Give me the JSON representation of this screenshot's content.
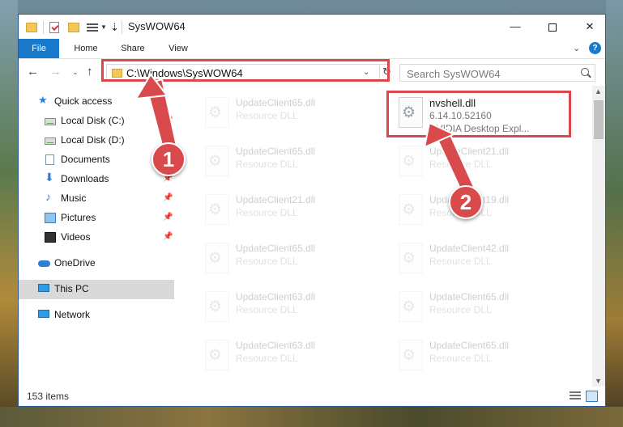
{
  "window": {
    "title": "SysWOW64",
    "controls": {
      "minimize": "—",
      "maximize": "",
      "close": "✕"
    }
  },
  "ribbon": {
    "tabs": [
      "File",
      "Home",
      "Share",
      "View"
    ],
    "chevron": "⌄",
    "help": "?"
  },
  "nav": {
    "back": "←",
    "forward": "→",
    "recent": "⌄",
    "up": "↑",
    "address": "C:\\Windows\\SysWOW64",
    "address_dropdown": "⌄",
    "refresh": "↻",
    "search_placeholder": "Search SysWOW64"
  },
  "sidebar": {
    "items": [
      {
        "label": "Quick access",
        "icon": "star-icon",
        "pinned": false
      },
      {
        "label": "Local Disk (C:)",
        "icon": "drive-icon",
        "pinned": true
      },
      {
        "label": "Local Disk (D:)",
        "icon": "drive-icon",
        "pinned": true
      },
      {
        "label": "Documents",
        "icon": "documents-icon",
        "pinned": true
      },
      {
        "label": "Downloads",
        "icon": "downloads-icon",
        "pinned": true
      },
      {
        "label": "Music",
        "icon": "music-icon",
        "pinned": true
      },
      {
        "label": "Pictures",
        "icon": "pictures-icon",
        "pinned": true
      },
      {
        "label": "Videos",
        "icon": "videos-icon",
        "pinned": true
      },
      {
        "label": "OneDrive",
        "icon": "onedrive-icon",
        "pinned": false
      },
      {
        "label": "This PC",
        "icon": "this-pc-icon",
        "pinned": false,
        "selected": true
      },
      {
        "label": "Network",
        "icon": "network-icon",
        "pinned": false
      }
    ],
    "pin_glyph": "📌"
  },
  "files": {
    "left_column": [
      {
        "name": "UpdateClient65.dll",
        "type": "Resource DLL"
      },
      {
        "name": "UpdateClient65.dll",
        "type": "Resource DLL"
      },
      {
        "name": "UpdateClient21.dll",
        "type": "Resource DLL"
      },
      {
        "name": "UpdateClient65.dll",
        "type": "Resource DLL"
      },
      {
        "name": "UpdateClient63.dll",
        "type": "Resource DLL"
      },
      {
        "name": "UpdateClient63.dll",
        "type": "Resource DLL"
      }
    ],
    "right_column": [
      {
        "name": "UpdateClient21.dll",
        "type": "Resource DLL"
      },
      {
        "name": "UpdateClient19.dll",
        "type": "Resource DLL"
      },
      {
        "name": "UpdateClient42.dll",
        "type": "Resource DLL"
      },
      {
        "name": "UpdateClient65.dll",
        "type": "Resource DLL"
      },
      {
        "name": "UpdateClient65.dll",
        "type": "Resource DLL"
      }
    ],
    "highlighted": {
      "name": "nvshell.dll",
      "version": "6.14.10.52160",
      "description": "NVIDIA Desktop Expl..."
    }
  },
  "status": {
    "item_count": "153 items"
  },
  "callouts": {
    "step1": "1",
    "step2": "2"
  },
  "colors": {
    "accent": "#1979ca",
    "callout": "#d94a4d"
  }
}
